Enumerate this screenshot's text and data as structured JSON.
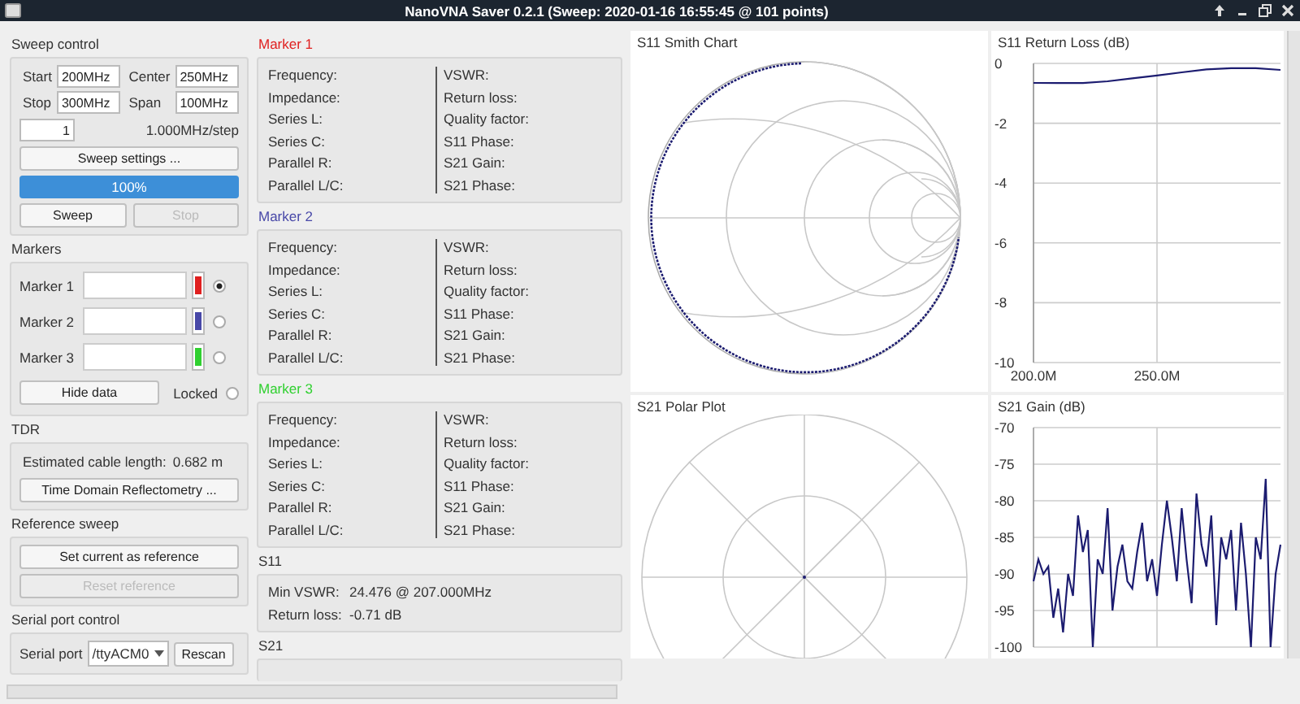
{
  "window": {
    "title": "NanoVNA Saver 0.2.1 (Sweep: 2020-01-16 16:55:45 @ 101 points)"
  },
  "sweep_control": {
    "title": "Sweep control",
    "fields": [
      {
        "label": "Start",
        "value": "200MHz"
      },
      {
        "label": "Center",
        "value": "250MHz"
      },
      {
        "label": "Stop",
        "value": "300MHz"
      },
      {
        "label": "Span",
        "value": "100MHz"
      }
    ],
    "segments": "1",
    "step": "1.000MHz/step",
    "settings_button": "Sweep settings ...",
    "progress": {
      "level": 1,
      "label": "100%"
    },
    "buttons": [
      {
        "label": "Sweep",
        "disabled": false
      },
      {
        "label": "Stop",
        "disabled": true
      }
    ]
  },
  "markers": {
    "title": "Markers",
    "items": [
      {
        "label": "Marker 1",
        "color": "#e02020",
        "selected": true
      },
      {
        "label": "Marker 2",
        "color": "#4848a8",
        "selected": false
      },
      {
        "label": "Marker 3",
        "color": "#30d030",
        "selected": false
      }
    ],
    "hide_button": "Hide data",
    "locked": {
      "label": "Locked",
      "checked": false
    }
  },
  "tdr": {
    "title": "TDR",
    "cable_length_label": "Estimated cable length:",
    "cable_length": "0.682 m",
    "button": "Time Domain Reflectometry ..."
  },
  "reference_sweep": {
    "title": "Reference sweep",
    "buttons": [
      {
        "label": "Set current as reference",
        "disabled": false
      },
      {
        "label": "Reset reference",
        "disabled": true
      }
    ]
  },
  "serial_port": {
    "title": "Serial port control",
    "label": "Serial port",
    "port": "/ttyACM0",
    "button": "Rescan"
  },
  "marker_details": [
    {
      "title": "Marker 1",
      "left": [
        "Frequency:",
        "Impedance:",
        "Series L:",
        "Series C:",
        "Parallel R:",
        "Parallel L/C:"
      ],
      "right": [
        "VSWR:",
        "Return loss:",
        "Quality factor:",
        "S11 Phase:",
        "S21 Gain:",
        "S21 Phase:"
      ]
    },
    {
      "title": "Marker 2",
      "left": [
        "Frequency:",
        "Impedance:",
        "Series L:",
        "Series C:",
        "Parallel R:",
        "Parallel L/C:"
      ],
      "right": [
        "VSWR:",
        "Return loss:",
        "Quality factor:",
        "S11 Phase:",
        "S21 Gain:",
        "S21 Phase:"
      ]
    },
    {
      "title": "Marker 3",
      "left": [
        "Frequency:",
        "Impedance:",
        "Series L:",
        "Series C:",
        "Parallel R:",
        "Parallel L/C:"
      ],
      "right": [
        "VSWR:",
        "Return loss:",
        "Quality factor:",
        "S11 Phase:",
        "S21 Gain:",
        "S21 Phase:"
      ]
    }
  ],
  "s11": {
    "title": "S11",
    "rows": [
      {
        "label": "Min VSWR:",
        "value": "24.476 @ 207.000MHz"
      },
      {
        "label": "Return loss:",
        "value": "-0.71 dB"
      }
    ]
  },
  "s21": {
    "title": "S21"
  },
  "charts": [
    {
      "kind": "smith",
      "title": "S11 Smith Chart"
    },
    {
      "kind": "line",
      "title": "S11 Return Loss (dB)",
      "chart_data": {
        "type": "line",
        "x": [
          200,
          210,
          220,
          230,
          240,
          250,
          260,
          270,
          280,
          290,
          300
        ],
        "xlim": [
          200,
          300
        ],
        "ylim": [
          -10,
          0
        ],
        "yticks": [
          0,
          -2,
          -4,
          -6,
          -8,
          -10
        ],
        "grid": true,
        "xticks": [
          {
            "value": 200,
            "label": "200.0M"
          },
          {
            "value": 250,
            "label": "250.0M"
          }
        ],
        "series": [
          {
            "color": "#1c1c70",
            "values": [
              -0.65,
              -0.66,
              -0.66,
              -0.6,
              -0.5,
              -0.4,
              -0.3,
              -0.2,
              -0.16,
              -0.16,
              -0.22
            ]
          }
        ]
      }
    },
    {
      "kind": "polar",
      "title": "S21 Polar Plot"
    },
    {
      "kind": "line",
      "title": "S21 Gain (dB)",
      "chart_data": {
        "type": "line",
        "grid": true,
        "ylim": [
          -100,
          -70
        ],
        "yticks": [
          -70,
          -75,
          -80,
          -85,
          -90,
          -95,
          -100
        ],
        "series": [
          {
            "color": "#1c1c70",
            "values": [
              -91,
              -88,
              -90,
              -89,
              -96,
              -92,
              -98,
              -90,
              -93,
              -82,
              -87,
              -84,
              -100,
              -88,
              -90,
              -81,
              -95,
              -89,
              -86,
              -91,
              -92,
              -87,
              -83,
              -91,
              -88,
              -93,
              -86,
              -80,
              -85,
              -91,
              -81,
              -88,
              -94,
              -79,
              -86,
              -89,
              -82,
              -97,
              -85,
              -88,
              -84,
              -95,
              -83,
              -90,
              -100,
              -85,
              -88,
              -77,
              -100,
              -90,
              -86
            ]
          }
        ]
      }
    }
  ]
}
